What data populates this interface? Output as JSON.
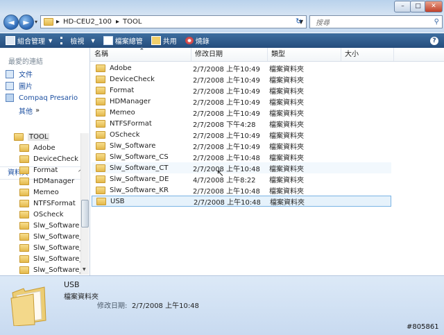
{
  "window": {
    "minimize": "–",
    "maximize": "□",
    "close": "✕"
  },
  "nav": {
    "back": "◄",
    "forward": "►"
  },
  "address": {
    "crumbs": [
      "HD-CEU2_100",
      "TOOL"
    ],
    "sep": "▸"
  },
  "search": {
    "placeholder": "搜尋"
  },
  "toolbar": {
    "organize": "組合管理",
    "views": "檢視",
    "explore": "檔案總管",
    "share": "共用",
    "burn": "燒錄"
  },
  "navpane": {
    "favorites_heading": "最愛的連結",
    "favorites": [
      "文件",
      "圖片",
      "Compaq Presario"
    ],
    "more": "其他",
    "more_arrow": "»",
    "folders_heading": "資料夾",
    "folders_arrow": "^",
    "tree_root": "TOOL",
    "tree": [
      "Adobe",
      "DeviceCheck",
      "Format",
      "HDManager",
      "Memeo",
      "NTFSFormat",
      "OScheck",
      "Slw_Software",
      "Slw_Software_C",
      "Slw_Software_C",
      "Slw_Software_D",
      "Slw_Software_K"
    ]
  },
  "list": {
    "columns": [
      "名稱",
      "修改日期",
      "類型",
      "大小"
    ],
    "rows": [
      {
        "name": "Adobe",
        "date": "2/7/2008 上午10:49",
        "type": "檔案資料夾"
      },
      {
        "name": "DeviceCheck",
        "date": "2/7/2008 上午10:49",
        "type": "檔案資料夾"
      },
      {
        "name": "Format",
        "date": "2/7/2008 上午10:49",
        "type": "檔案資料夾"
      },
      {
        "name": "HDManager",
        "date": "2/7/2008 上午10:49",
        "type": "檔案資料夾"
      },
      {
        "name": "Memeo",
        "date": "2/7/2008 上午10:49",
        "type": "檔案資料夾"
      },
      {
        "name": "NTFSFormat",
        "date": "2/7/2008 下午4:28",
        "type": "檔案資料夾"
      },
      {
        "name": "OScheck",
        "date": "2/7/2008 上午10:49",
        "type": "檔案資料夾"
      },
      {
        "name": "Slw_Software",
        "date": "2/7/2008 上午10:49",
        "type": "檔案資料夾"
      },
      {
        "name": "Slw_Software_CS",
        "date": "2/7/2008 上午10:48",
        "type": "檔案資料夾"
      },
      {
        "name": "Slw_Software_CT",
        "date": "2/7/2008 上午10:48",
        "type": "檔案資料夾"
      },
      {
        "name": "Slw_Software_DE",
        "date": "4/7/2008 上午8:22",
        "type": "檔案資料夾"
      },
      {
        "name": "Slw_Software_KR",
        "date": "2/7/2008 上午10:48",
        "type": "檔案資料夾"
      },
      {
        "name": "USB",
        "date": "2/7/2008 上午10:48",
        "type": "檔案資料夾"
      }
    ]
  },
  "details": {
    "name": "USB",
    "type": "檔案資料夾",
    "modified_label": "修改日期:",
    "modified_value": "2/7/2008 上午10:48"
  },
  "watermark": "#805861",
  "colors": {
    "toolbar": "#2f5d8f",
    "accent": "#1c4fa0",
    "selection": "#e6f2fb"
  }
}
